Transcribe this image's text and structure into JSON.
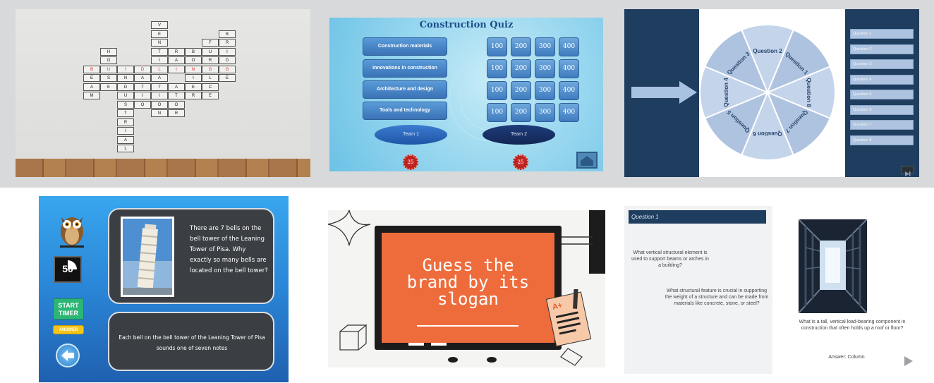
{
  "crossword": {
    "cells": [
      {
        "c": "V",
        "x": 5,
        "y": 0
      },
      {
        "c": "E",
        "x": 5,
        "y": 1
      },
      {
        "c": "N",
        "x": 5,
        "y": 2
      },
      {
        "c": "T",
        "x": 5,
        "y": 3
      },
      {
        "c": "I",
        "x": 5,
        "y": 4
      },
      {
        "c": "L",
        "x": 5,
        "y": 5,
        "red": true
      },
      {
        "c": "A",
        "x": 5,
        "y": 6
      },
      {
        "c": "T",
        "x": 5,
        "y": 7
      },
      {
        "c": "I",
        "x": 5,
        "y": 8
      },
      {
        "c": "O",
        "x": 5,
        "y": 9
      },
      {
        "c": "N",
        "x": 5,
        "y": 10
      },
      {
        "c": "H",
        "x": 2,
        "y": 3
      },
      {
        "c": "O",
        "x": 2,
        "y": 4
      },
      {
        "c": "U",
        "x": 2,
        "y": 5,
        "red": true
      },
      {
        "c": "S",
        "x": 2,
        "y": 6
      },
      {
        "c": "E",
        "x": 2,
        "y": 7
      },
      {
        "c": "B",
        "x": 1,
        "y": 5,
        "red": true
      },
      {
        "c": "E",
        "x": 1,
        "y": 6
      },
      {
        "c": "A",
        "x": 1,
        "y": 7
      },
      {
        "c": "M",
        "x": 1,
        "y": 8
      },
      {
        "c": "I",
        "x": 3,
        "y": 5,
        "red": true
      },
      {
        "c": "D",
        "x": 4,
        "y": 5,
        "red": true
      },
      {
        "c": "I",
        "x": 6,
        "y": 5,
        "red": true
      },
      {
        "c": "N",
        "x": 7,
        "y": 5,
        "red": true
      },
      {
        "c": "G",
        "x": 8,
        "y": 5,
        "red": true
      },
      {
        "c": "N",
        "x": 3,
        "y": 6
      },
      {
        "c": "A",
        "x": 4,
        "y": 6
      },
      {
        "c": "D",
        "x": 3,
        "y": 7
      },
      {
        "c": "T",
        "x": 4,
        "y": 7
      },
      {
        "c": "U",
        "x": 3,
        "y": 8
      },
      {
        "c": "S",
        "x": 3,
        "y": 9
      },
      {
        "c": "T",
        "x": 3,
        "y": 10
      },
      {
        "c": "R",
        "x": 3,
        "y": 11
      },
      {
        "c": "I",
        "x": 3,
        "y": 12
      },
      {
        "c": "A",
        "x": 3,
        "y": 13
      },
      {
        "c": "L",
        "x": 3,
        "y": 14
      },
      {
        "c": "R",
        "x": 6,
        "y": 3
      },
      {
        "c": "A",
        "x": 6,
        "y": 4
      },
      {
        "c": "A",
        "x": 6,
        "y": 7
      },
      {
        "c": "T",
        "x": 6,
        "y": 8
      },
      {
        "c": "O",
        "x": 6,
        "y": 9
      },
      {
        "c": "R",
        "x": 6,
        "y": 10
      },
      {
        "c": "B",
        "x": 7,
        "y": 3
      },
      {
        "c": "O",
        "x": 7,
        "y": 4
      },
      {
        "c": "E",
        "x": 7,
        "y": 7
      },
      {
        "c": "R",
        "x": 7,
        "y": 8
      },
      {
        "c": "U",
        "x": 8,
        "y": 3
      },
      {
        "c": "R",
        "x": 8,
        "y": 4
      },
      {
        "c": "C",
        "x": 8,
        "y": 7
      },
      {
        "c": "E",
        "x": 8,
        "y": 8
      },
      {
        "c": "F",
        "x": 8,
        "y": 2
      },
      {
        "c": "L",
        "x": 8,
        "y": 6
      },
      {
        "c": "B",
        "x": 9,
        "y": 1
      },
      {
        "c": "R",
        "x": 9,
        "y": 2
      },
      {
        "c": "I",
        "x": 9,
        "y": 3
      },
      {
        "c": "D",
        "x": 9,
        "y": 4
      },
      {
        "c": "G",
        "x": 9,
        "y": 5,
        "red": true
      },
      {
        "c": "E",
        "x": 9,
        "y": 6
      },
      {
        "c": "I",
        "x": 4,
        "y": 8
      },
      {
        "c": "E",
        "x": 4,
        "y": 6
      },
      {
        "c": "O",
        "x": 4,
        "y": 9
      },
      {
        "c": "I",
        "x": 7,
        "y": 6
      },
      {
        "c": "A",
        "x": 7,
        "y": 6.0001
      }
    ]
  },
  "quiz": {
    "title": "Construction Quiz",
    "categories": [
      "Construction materials",
      "Innovations in construction",
      "Architecture and design",
      "Tools and technology"
    ],
    "points": [
      "100",
      "200",
      "300",
      "400"
    ],
    "team1": "Team 1",
    "team2": "Team 2",
    "score1": "25",
    "score2": "25"
  },
  "wheel": {
    "labels": [
      "Question 1",
      "Question 2",
      "Question 3",
      "Question 4",
      "Question 5",
      "Question 6",
      "Question 7",
      "Question 8"
    ],
    "list": [
      "Question 1",
      "Question 2",
      "Question 3",
      "Question 4",
      "Question 5",
      "Question 6",
      "Question 7",
      "Question 8"
    ]
  },
  "pisa": {
    "timer": "50",
    "start_timer": "START TIMER",
    "answer_btn": "ANSWER",
    "question": "There are 7 bells on the bell tower of the Leaning Tower of Pisa. Why exactly so many bells are located on the bell tower?",
    "answer": "Each bell on the bell tower of the Leaning Tower of Pisa sounds one of seven notes"
  },
  "brand": {
    "headline_1": "Guess the",
    "headline_2": "brand by its",
    "headline_3": "slogan"
  },
  "question_card": {
    "header": "Question 1",
    "q1": "What vertical structural element is used to support beams or arches in a building?",
    "q2": "What structural feature is crucial in supporting the weight of a structure and can be made from materials like concrete, stone, or steel?"
  },
  "column_card": {
    "question": "What is a tall, vertical load-bearing component in construction that often holds up a roof or floor?",
    "answer": "Answer: Column"
  }
}
